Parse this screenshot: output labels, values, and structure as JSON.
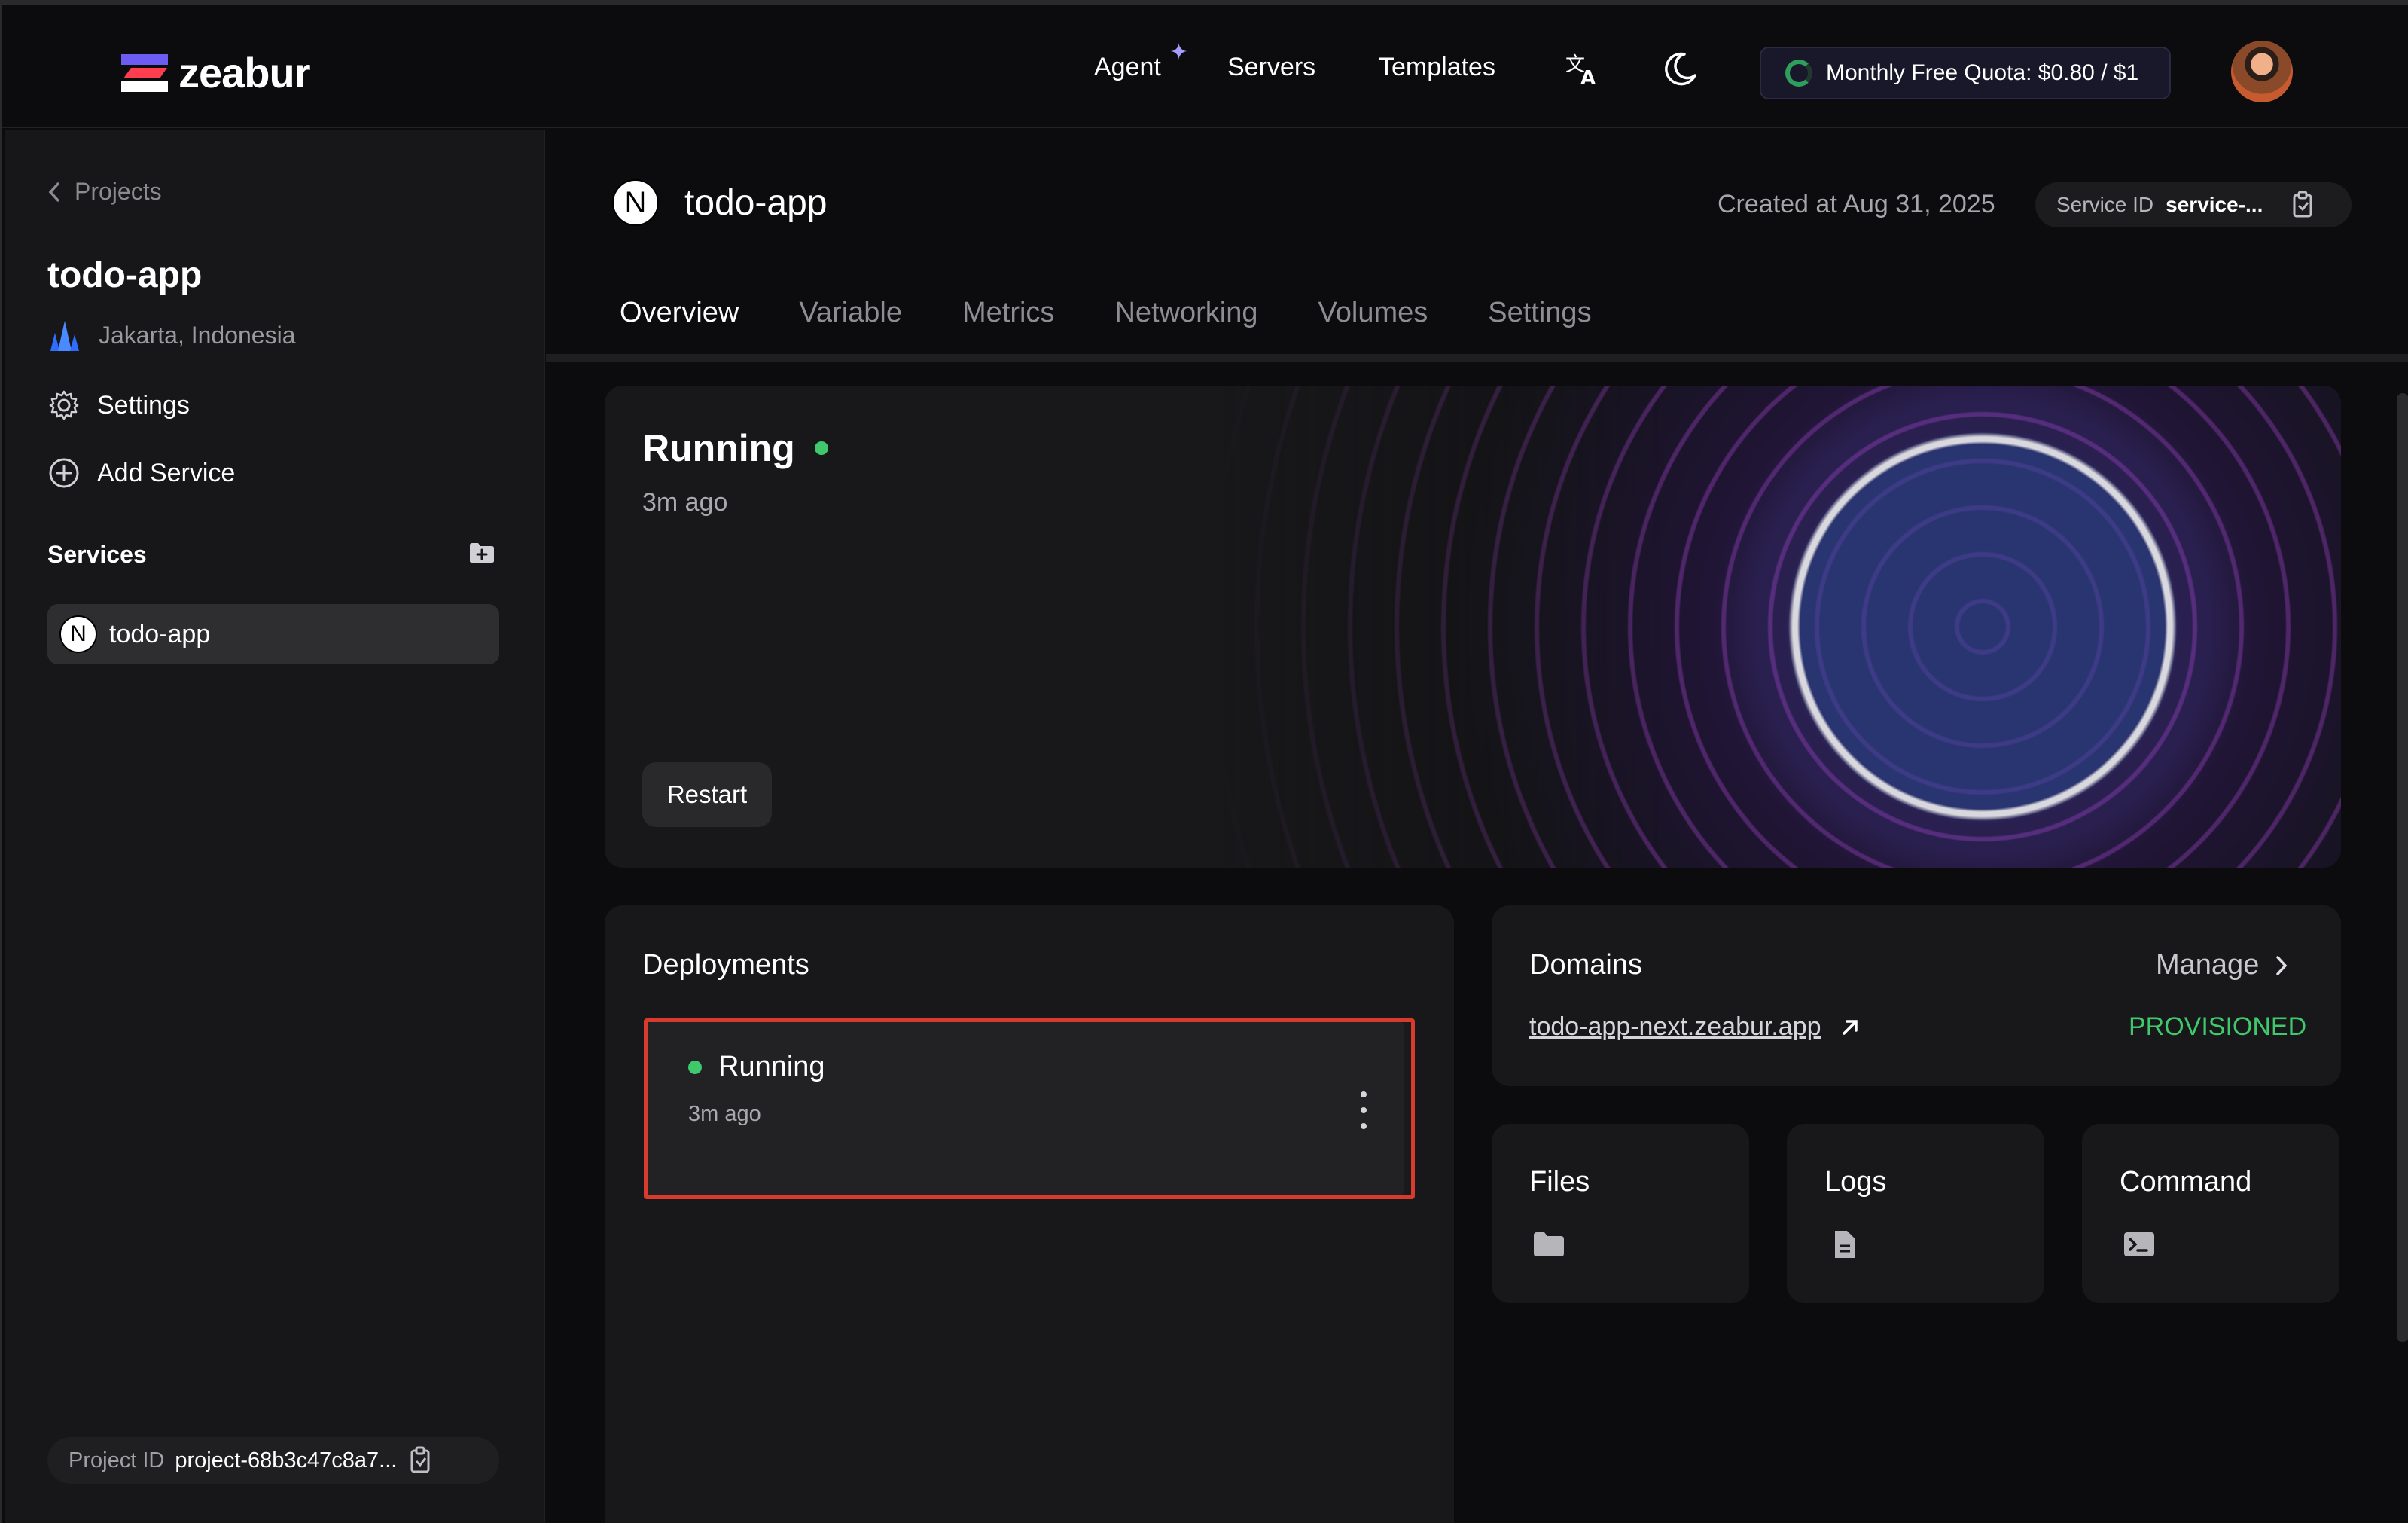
{
  "header": {
    "brand": "zeabur",
    "nav": {
      "agent": "Agent",
      "servers": "Servers",
      "templates": "Templates"
    },
    "quota": "Monthly Free Quota: $0.80 / $1",
    "icons": [
      "translate-icon",
      "moon-icon",
      "avatar"
    ]
  },
  "sidebar": {
    "back_label": "Projects",
    "project_name": "todo-app",
    "region": "Jakarta, Indonesia",
    "settings_label": "Settings",
    "add_service_label": "Add Service",
    "services_heading": "Services",
    "services": [
      {
        "name": "todo-app"
      }
    ],
    "project_id_label": "Project ID",
    "project_id_value": "project-68b3c47c8a7..."
  },
  "service": {
    "name": "todo-app",
    "created_at": "Created at Aug 31, 2025",
    "service_id_label": "Service ID",
    "service_id_value": "service-..."
  },
  "tabs": [
    "Overview",
    "Variable",
    "Metrics",
    "Networking",
    "Volumes",
    "Settings"
  ],
  "status": {
    "label": "Running",
    "ago": "3m ago",
    "restart_label": "Restart"
  },
  "deployments": {
    "heading": "Deployments",
    "items": [
      {
        "status": "Running",
        "ago": "3m ago"
      }
    ]
  },
  "domains": {
    "heading": "Domains",
    "manage_label": "Manage",
    "items": [
      {
        "url": "todo-app-next.zeabur.app",
        "status": "PROVISIONED"
      }
    ]
  },
  "tools": {
    "files": "Files",
    "logs": "Logs",
    "command": "Command"
  },
  "colors": {
    "accent_green": "#3fc86c",
    "highlight_red": "#d83a2c"
  }
}
